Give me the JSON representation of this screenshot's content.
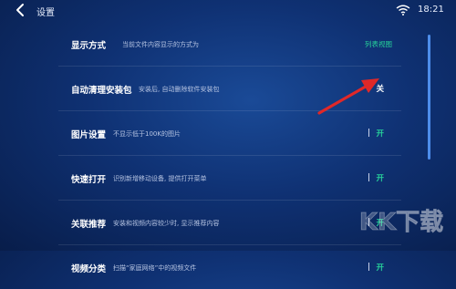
{
  "header": {
    "title": "设置",
    "time": "18:21"
  },
  "settings": [
    {
      "label": "显示方式",
      "description": "当前文件内容显示的方式为",
      "value": "列表视图"
    },
    {
      "label": "自动清理安装包",
      "description": "安装后, 自动删除软件安装包",
      "toggle": "关"
    },
    {
      "label": "图片设置",
      "description": "不显示低于100K的图片",
      "toggle": "开"
    },
    {
      "label": "快速打开",
      "description": "识别新增移动设备, 提供打开菜单",
      "toggle": "开"
    },
    {
      "label": "关联推荐",
      "description": "安装和视频内容较少时, 显示推荐内容",
      "toggle": "开"
    },
    {
      "label": "视频分类",
      "description": "扫描“家庭网络”中的视频文件",
      "toggle": "开"
    }
  ],
  "colors": {
    "accent_green": "#27d39a",
    "arrow_red": "#e02828",
    "scrollbar": "#4d8dea",
    "background": "#0f3173"
  },
  "icons": [
    "back-arrow-icon",
    "wifi-icon"
  ]
}
